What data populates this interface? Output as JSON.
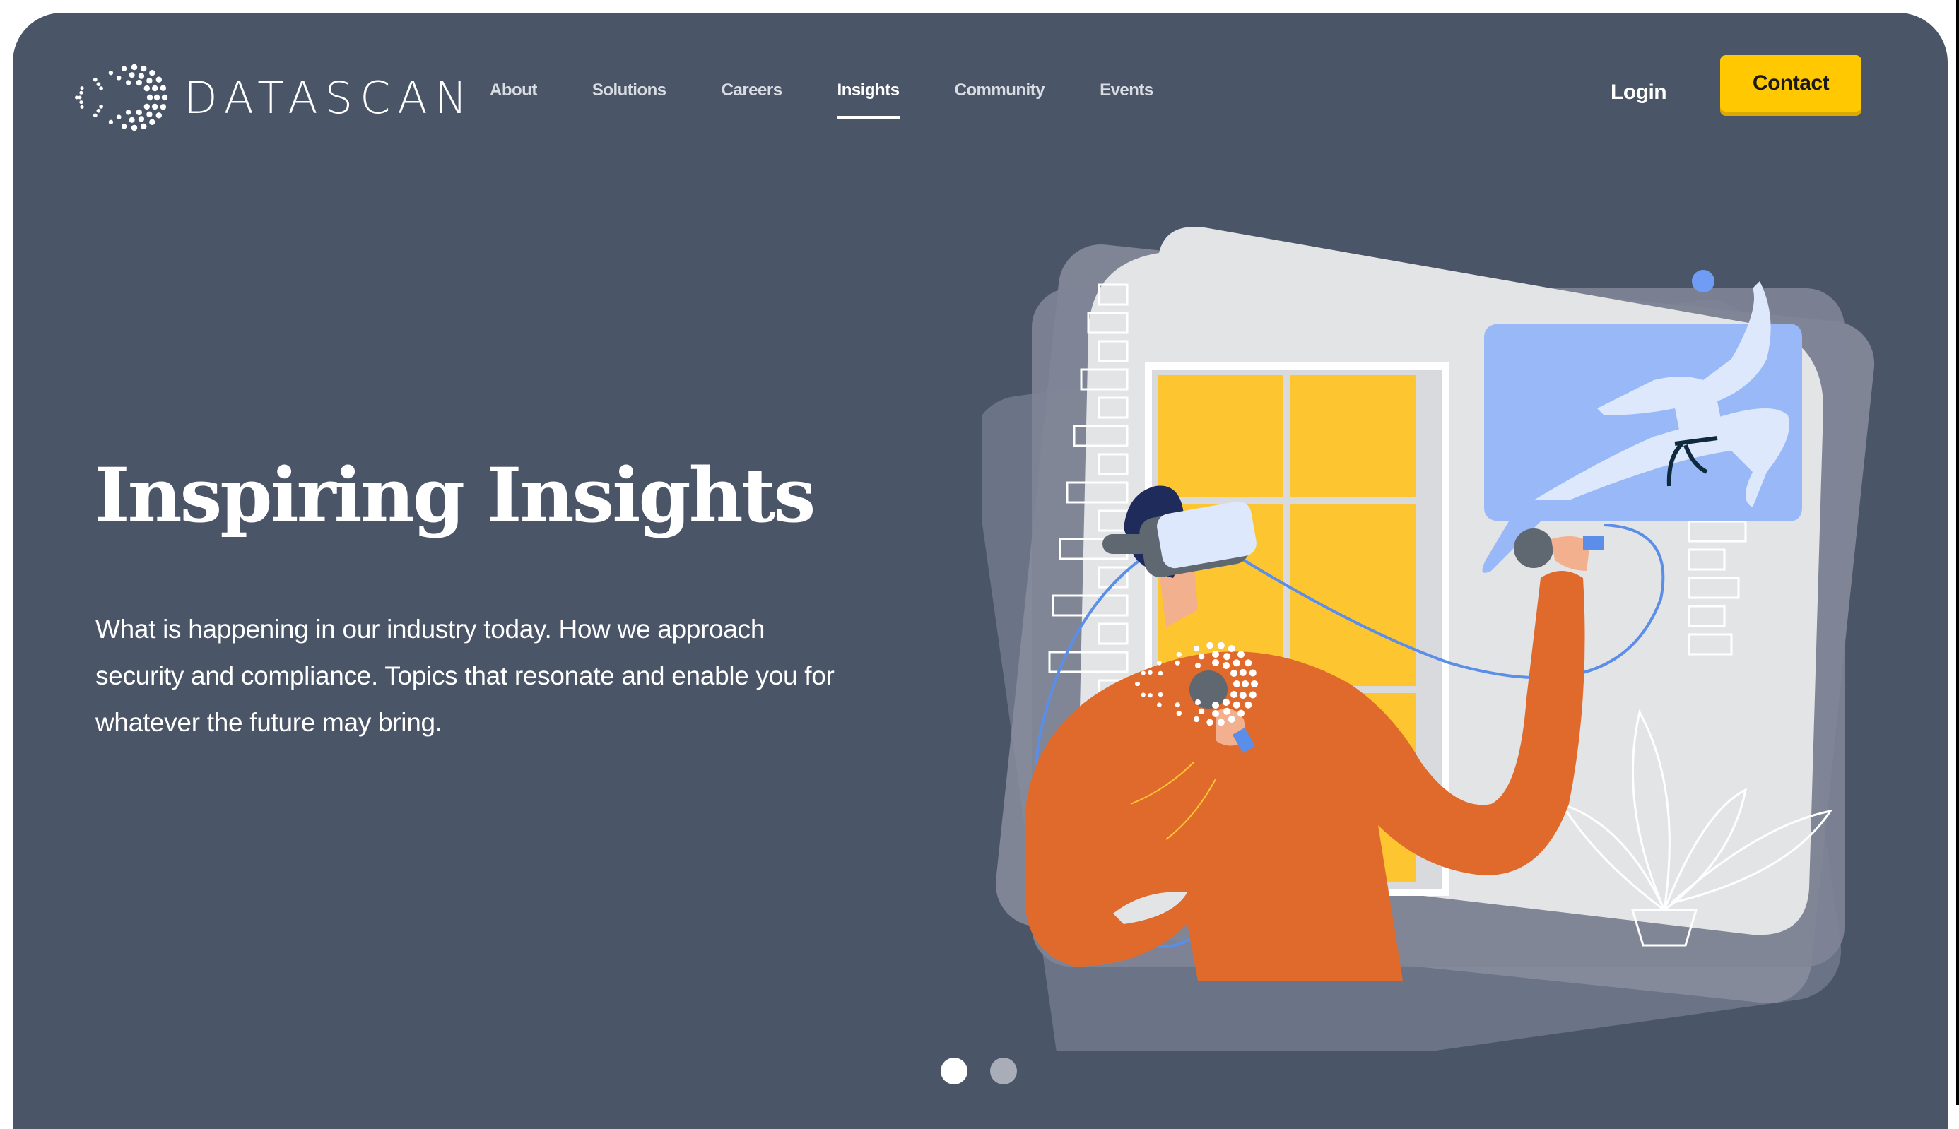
{
  "brand": {
    "name": "DATASCAN",
    "logo_icon": "dotted-ring-logo"
  },
  "nav": {
    "items": [
      {
        "label": "About",
        "active": false
      },
      {
        "label": "Solutions",
        "active": false
      },
      {
        "label": "Careers",
        "active": false
      },
      {
        "label": "Insights",
        "active": true
      },
      {
        "label": "Community",
        "active": false
      },
      {
        "label": "Events",
        "active": false
      }
    ],
    "login_label": "Login",
    "contact_label": "Contact"
  },
  "hero": {
    "title": "Inspiring Insights",
    "description": "What is happening in our industry today. How we approach security and compliance. Topics that resonate and enable you for whatever the future may bring.",
    "illustration": "person-with-vr-headset-and-controllers-watching-karate-figure"
  },
  "carousel": {
    "slide_count": 2,
    "active_index": 0
  },
  "colors": {
    "background": "#4b5568",
    "accent": "#ffc800",
    "text": "#ffffff",
    "nav_text": "#d9dce2",
    "dot_inactive": "#a8adb7",
    "illus_orange": "#e06a2c",
    "illus_yellow": "#fdc530",
    "illus_blue": "#98b8f8",
    "illus_light": "#e3e4e6"
  }
}
